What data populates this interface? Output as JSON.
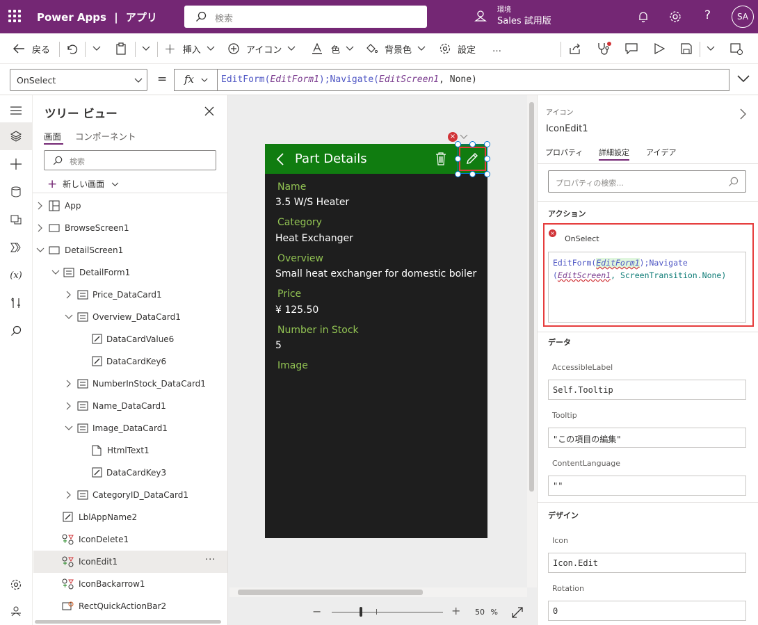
{
  "app": {
    "product": "Power Apps",
    "separator": "|",
    "section": "アプリ",
    "search_placeholder": "検索",
    "env_label": "環境",
    "env_name": "Sales 試用版",
    "user_initials": "SA"
  },
  "toolbar": {
    "back": "戻る",
    "insert": "挿入",
    "icon": "アイコン",
    "color": "色",
    "bg_color": "背景色",
    "settings": "設定",
    "more": "…"
  },
  "formula_bar": {
    "property": "OnSelect",
    "equals": "=",
    "fx": "fx",
    "formula_parts": [
      "EditForm(",
      "EditForm1",
      ");Navigate(",
      "EditScreen1",
      ", None)"
    ]
  },
  "tree": {
    "title": "ツリー ビュー",
    "tab_screens": "画面",
    "tab_components": "コンポーネント",
    "search_placeholder": "検索",
    "new_screen": "新しい画面",
    "items": [
      {
        "label": "App"
      },
      {
        "label": "BrowseScreen1"
      },
      {
        "label": "DetailScreen1"
      },
      {
        "label": "DetailForm1"
      },
      {
        "label": "Price_DataCard1"
      },
      {
        "label": "Overview_DataCard1"
      },
      {
        "label": "DataCardValue6"
      },
      {
        "label": "DataCardKey6"
      },
      {
        "label": "NumberInStock_DataCard1"
      },
      {
        "label": "Name_DataCard1"
      },
      {
        "label": "Image_DataCard1"
      },
      {
        "label": "HtmlText1"
      },
      {
        "label": "DataCardKey3"
      },
      {
        "label": "CategoryID_DataCard1"
      },
      {
        "label": "LblAppName2"
      },
      {
        "label": "IconDelete1"
      },
      {
        "label": "IconEdit1"
      },
      {
        "label": "IconBackarrow1"
      },
      {
        "label": "RectQuickActionBar2"
      }
    ],
    "selected_more": "···"
  },
  "phone": {
    "title": "Part Details",
    "fields": [
      {
        "label": "Name",
        "value": "3.5 W/S Heater"
      },
      {
        "label": "Category",
        "value": "Heat Exchanger"
      },
      {
        "label": "Overview",
        "value": "Small heat exchanger for domestic boiler"
      },
      {
        "label": "Price",
        "value": "¥ 125.50"
      },
      {
        "label": "Number in Stock",
        "value": "5"
      },
      {
        "label": "Image",
        "value": ""
      }
    ]
  },
  "canvas": {
    "zoom": "50",
    "zoom_unit": "%",
    "minus": "−",
    "plus": "+"
  },
  "right_panel": {
    "type": "アイコン",
    "name": "IconEdit1",
    "tab_properties": "プロパティ",
    "tab_advanced": "詳細設定",
    "tab_ideas": "アイデア",
    "search_placeholder": "プロパティの検索...",
    "section_action": "アクション",
    "onselect_label": "OnSelect",
    "onselect_code": [
      "EditForm(",
      "EditForm1",
      ");Navigate",
      "(",
      "EditScreen1",
      ", ScreenTransition.None)"
    ],
    "section_data": "データ",
    "accessible_label": "AccessibleLabel",
    "accessible_value": "Self.Tooltip",
    "tooltip_label": "Tooltip",
    "tooltip_value": "\"この項目の編集\"",
    "content_language_label": "ContentLanguage",
    "content_language_value": "\"\"",
    "section_design": "デザイン",
    "icon_label": "Icon",
    "icon_value": "Icon.Edit",
    "rotation_label": "Rotation",
    "rotation_value": "0"
  },
  "colors": {
    "brand": "#742774",
    "header_green": "#107c10",
    "label_green": "#92c353",
    "error_red": "#d13438",
    "selection_blue": "#0078d4"
  }
}
